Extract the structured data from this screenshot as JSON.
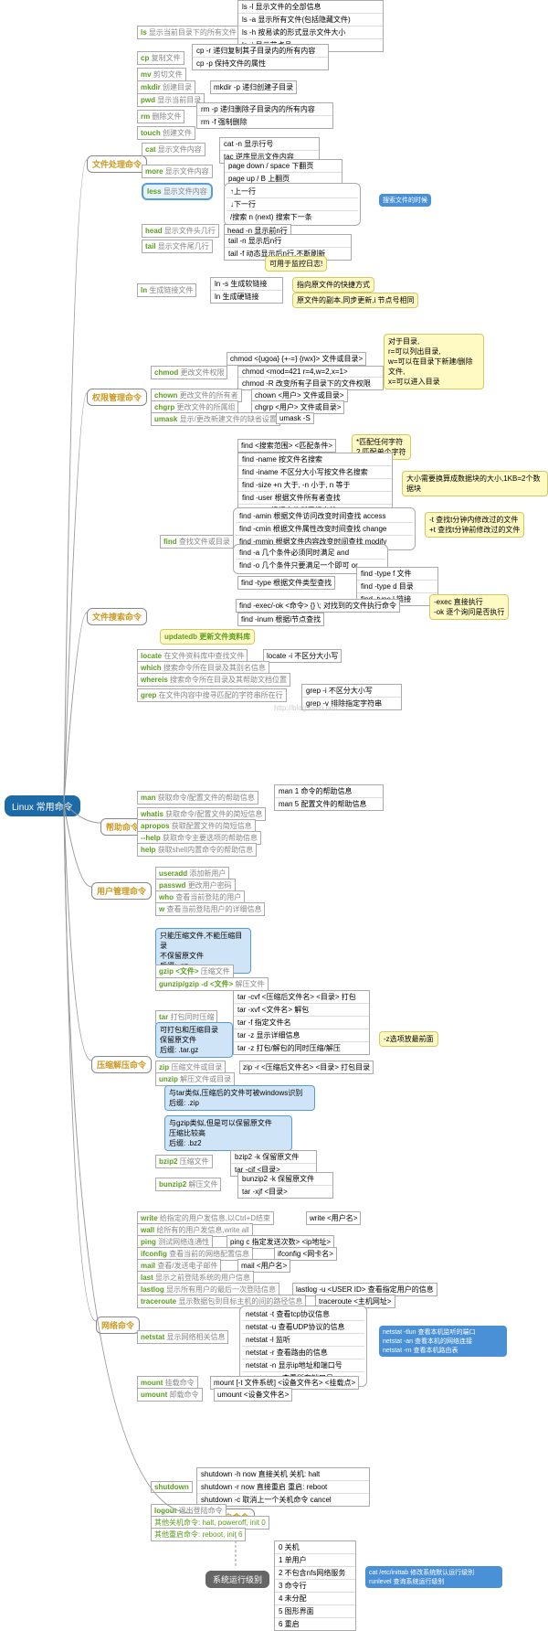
{
  "root": "Linux 常用命令",
  "branches": {
    "file": "文件处理命令",
    "perm": "权限管理命令",
    "search": "文件搜索命令",
    "help": "帮助命令",
    "user": "用户管理命令",
    "compress": "压缩解压命令",
    "net": "网络命令",
    "shutdown": "关机/重启命令"
  },
  "file": {
    "ls": {
      "label": "ls",
      "desc": "显示当前目录下的所有文件",
      "opts": [
        "ls -l 显示文件的全部信息",
        "ls -a 显示所有文件(包括隐藏文件)",
        "ls -h 按易读的形式显示文件大小",
        "ls -i 显示节点号"
      ]
    },
    "cp": {
      "label": "cp",
      "desc": "复制文件",
      "opts": [
        "cp -r 递归复制其子目录内的所有内容",
        "cp -p 保持文件的属性"
      ]
    },
    "mv": {
      "label": "mv",
      "desc": "剪切文件"
    },
    "mkdir": {
      "label": "mkdir",
      "desc": "创建目录",
      "opt": "mkdir -p 递归创建子目录"
    },
    "pwd": {
      "label": "pwd",
      "desc": "显示当前目录"
    },
    "rm": {
      "label": "rm",
      "desc": "删除文件",
      "opts": [
        "rm -p 递归删除子目录内的所有内容",
        "rm -f 强制删除"
      ]
    },
    "touch": {
      "label": "touch",
      "desc": "创建文件"
    },
    "cat": {
      "label": "cat",
      "desc": "显示文件内容",
      "opts": [
        "cat -n 显示行号",
        "tac 逆序显示文件内容"
      ]
    },
    "more": {
      "label": "more",
      "desc": "显示文件内容",
      "opts": [
        "page down / space 下翻页",
        "page up / B 上翻页"
      ]
    },
    "less": {
      "label": "less",
      "desc": "显示文件内容",
      "opts": [
        "↑上一行",
        "↓下一行",
        "/搜索    n (next) 搜索下一条"
      ],
      "tag": "搜索文件的时候"
    },
    "head": {
      "label": "head",
      "desc": "显示文件头几行",
      "opt": "head -n 显示前n行"
    },
    "tail": {
      "label": "tail",
      "desc": "显示文件尾几行",
      "opts": [
        "tail -n 显示后n行",
        "tail -f 动态显示后n行,不断刷新"
      ],
      "note": "可用于监控日志!"
    },
    "ln": {
      "label": "ln",
      "desc": "生成链接文件",
      "opts": [
        "ln -s 生成软链接",
        "ln 生成硬链接"
      ],
      "note1": "指向原文件的快捷方式",
      "note2": "原文件的副本,同步更新,i 节点号相同"
    }
  },
  "perm": {
    "chmod": {
      "label": "chmod",
      "desc": "更改文件权限",
      "line": "chmod <{ugoa} {+-=} {rwx}> 文件或目录>",
      "opts": [
        "chmod <mod=421    r=4,w=2,x=1>",
        "chmod -R 改变所有子目录下的文件权限"
      ],
      "note": "对于目录,\nr=可以列出目录,\nw=可以在目录下新建/删除文件,\nx=可以进入目录"
    },
    "chown": {
      "label": "chown",
      "desc": "更改文件的所有者",
      "opt": "chown <用户> 文件或目录>"
    },
    "chgrp": {
      "label": "chgrp",
      "desc": "更改文件的所属组",
      "opt": "chgrp <用户> 文件或目录>"
    },
    "umask": {
      "label": "umask",
      "desc": "显示/更改新建文件的缺省设置",
      "opt": "umask -S"
    }
  },
  "search": {
    "find": {
      "label": "find",
      "desc": "查找文件或目录",
      "main": "find <搜索范围> <匹配条件>",
      "rows": [
        "find -name 按文件名搜索",
        "find -iname 不区分大小写按文件名搜索",
        "find -size   +n 大于, -n 小于, n 等于",
        "find -user 根据文件所有者查找",
        "find -grp 根据文件所属组查找"
      ],
      "timegrp": [
        "find -amin 根据文件访问改变时间查找 access",
        "find -cmin 根据文件属性改变时间查找 change",
        "find -mmin 根据文件内容改变时间查找 modify"
      ],
      "andor": [
        "find -a    几个条件必须同时满足 and",
        "find -o    几个条件只要满足一个即可 or"
      ],
      "type": "find -type 根据文件类型查找",
      "types": [
        "find -type f 文件",
        "find -type d 目录",
        "find -type l 链接"
      ],
      "exec": "find -exec/-ok <命令> {} \\; 对找到的文件执行命令",
      "inum": "find -inum 根据i节点查找",
      "notewild": "*匹配任何字符\n? 匹配单个字符",
      "notesize": "大小需要换算成数据块的大小,1KB=2个数据块",
      "notetime": "-t 查找t分钟内修改过的文件\n+t 查找t分钟前修改过的文件",
      "noteexec": "-exec 直接执行\n-ok 逐个询问是否执行"
    },
    "updatedb": "updatedb 更新文件资料库",
    "locate": {
      "label": "locate",
      "desc": "在文件资料库中查找文件",
      "opt": "locate -i 不区分大小写"
    },
    "which": {
      "label": "which",
      "desc": "搜索命令所在目录及其别名信息"
    },
    "whereis": {
      "label": "whereis",
      "desc": "搜索命令所在目录及其帮助文档位置"
    },
    "grep": {
      "label": "grep",
      "desc": "在文件内容中搜寻匹配的字符串所在行",
      "opts": [
        "grep -i 不区分大小写",
        "grep -v 排除指定字符串"
      ]
    }
  },
  "help": {
    "man": {
      "label": "man",
      "desc": "获取命令/配置文件的帮助信息",
      "opts": [
        "man 1 命令的帮助信息",
        "man 5 配置文件的帮助信息"
      ]
    },
    "whatis": {
      "label": "whatis",
      "desc": "获取命令/配置文件的简短信息"
    },
    "apropos": {
      "label": "apropos",
      "desc": "获取配置文件的简短信息"
    },
    "help2": {
      "label": "--help",
      "desc": "获取命令主要选项的帮助信息"
    },
    "help3": {
      "label": "help",
      "desc": "获取shell内置命令的帮助信息"
    }
  },
  "user": {
    "useradd": {
      "label": "useradd",
      "desc": "添加新用户"
    },
    "passwd": {
      "label": "passwd",
      "desc": "更改用户密码"
    },
    "who": {
      "label": "who",
      "desc": "查看当前登陆的用户"
    },
    "w": {
      "label": "w",
      "desc": "查看当前登陆用户的详细信息"
    }
  },
  "compress": {
    "gzipnote": "只能压缩文件,不能压缩目录\n不保留原文件\n后缀: .gz",
    "gzip": {
      "label": "gzip <文件>",
      "desc": "压缩文件"
    },
    "gunzip": {
      "label": "gunzip/gzip -d <文件>",
      "desc": "解压文件"
    },
    "tar": {
      "label": "tar",
      "desc": "打包同时压缩",
      "opts": [
        "tar -cvf <压缩后文件名> <目录>  打包",
        "tar -xvf <文件名>  解包",
        "tar -f 指定文件名",
        "tar -z 显示详细信息",
        "tar -z 打包/解包的同时压缩/解压"
      ],
      "note": "-z选项放最前面"
    },
    "tarnote": "可打包和压缩目录\n保留原文件\n后缀: .tar.gz",
    "zip": {
      "label": "zip",
      "desc": "压缩文件或目录",
      "opt": "zip -r <压缩后文件名> <目录> 打包目录"
    },
    "unzip": {
      "label": "unzip",
      "desc": "解压文件或目录"
    },
    "zipnote": "与tar类似,压缩后的文件可被windows识别\n后缀: .zip",
    "bzipnote": "与gzip类似,但是可以保留原文件\n压缩比较高\n后缀: .bz2",
    "bzip2": {
      "label": "bzip2",
      "desc": "压缩文件",
      "opts": [
        "bzip2 -k 保留原文件",
        "tar -cjf <目录>"
      ]
    },
    "bunzip2": {
      "label": "bunzip2",
      "desc": "解压文件",
      "opts": [
        "bunzip2 -k 保留原文件",
        "tar -xjf <目录>"
      ]
    }
  },
  "net": {
    "write": {
      "label": "write",
      "desc": "给指定的用户发信息,以Ctrl+D结束",
      "opt": "write <用户名>"
    },
    "wall": {
      "label": "wall",
      "desc": "给所有的用户发信息,write all"
    },
    "ping": {
      "label": "ping",
      "desc": "测试网络连通性",
      "opt": "ping c 指定发送次数> <ip地址>"
    },
    "ifconfig": {
      "label": "ifconfig",
      "desc": "查看当前的网络配置信息",
      "opt": "ifconfig <网卡名>"
    },
    "mail": {
      "label": "mail",
      "desc": "查看/发送电子邮件",
      "opt": "mail <用户名>"
    },
    "last": {
      "label": "last",
      "desc": "显示之前登陆系统的用户信息"
    },
    "lastlog": {
      "label": "lastlog",
      "desc": "显示所有用户的最后一次登陆信息",
      "opt": "lastlog -u <USER ID> 查看指定用户的信息"
    },
    "traceroute": {
      "label": "traceroute",
      "desc": "显示数据包到目标主机的间的路径信息",
      "opt": "traceroute <主机网址>"
    },
    "netstat": {
      "label": "netstat",
      "desc": "显示网络相关信息",
      "opts": [
        "netstat -t 查看tcp协议信息",
        "netstat -u 查看UDP协议的信息",
        "netstat -l 监听",
        "netstat -r 查看路由的信息",
        "netstat -n 显示ip地址和端口号",
        "netstat -an 查看所有端口号"
      ],
      "note": "netstat -tlun 查看本机监听的端口\nnetstat -an 查看本机的网络连接\nnetstat -rn 查看本机路由表"
    },
    "mount": {
      "label": "mount",
      "desc": "挂载命令",
      "opt": "mount [-t 文件系统] <设备文件名> <挂载点>"
    },
    "umount": {
      "label": "umount",
      "desc": "卸载命令",
      "opt": "umount <设备文件名>"
    }
  },
  "shutdown": {
    "shutdown": {
      "label": "shutdown",
      "opts": [
        "shutdown -h now 直接关机 关机: halt",
        "shutdown -r now 直接重启 重启: reboot",
        "shutdown -c 取消上一个关机命令 cancel"
      ]
    },
    "logout": {
      "label": "logout",
      "desc": "退出登陆命令"
    },
    "other1": "其他关机命令: halt, poweroff, init 0",
    "other2": "其他重启命令: reboot, init 6",
    "runlevel": "系统运行级别",
    "levels": [
      "0 关机",
      "1 单用户",
      "2 不包含nfs网络服务",
      "3 命令行",
      "4 未分配",
      "5 图形界面",
      "6 重启"
    ],
    "catnote": "cat /etc/inittab 修改系统默认运行级别\nrunlevel 查询系统运行级别"
  },
  "wm": "http://blog.csdn.net/..."
}
